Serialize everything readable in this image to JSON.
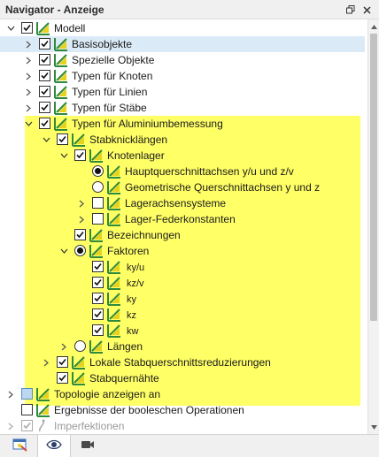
{
  "panel": {
    "title": "Navigator - Anzeige",
    "float_icon": "float-window-icon",
    "close_icon": "close-icon"
  },
  "colors": {
    "highlight": "#ffff66",
    "selection": "#dbeaf7",
    "icon_green": "#2e8b3a",
    "icon_yellow": "#e7d21e"
  },
  "tree": {
    "modell": "Modell",
    "basisobjekte": "Basisobjekte",
    "spezielle_objekte": "Spezielle Objekte",
    "typen_knoten": "Typen für Knoten",
    "typen_linien": "Typen für Linien",
    "typen_staebe": "Typen für Stäbe",
    "typen_alu": "Typen für Aluminiumbemessung",
    "stabknicklaengen": "Stabknicklängen",
    "knotenlager": "Knotenlager",
    "hauptquerschnitt": "Hauptquerschnittachsen y/u und z/v",
    "geometrische": "Geometrische Querschnittachsen y und z",
    "lagerachsensysteme": "Lagerachsensysteme",
    "lager_feder": "Lager-Federkonstanten",
    "bezeichnungen": "Bezeichnungen",
    "faktoren": "Faktoren",
    "ky_u": "ky/u",
    "kz_v": "kz/v",
    "ky": "ky",
    "kz": "kz",
    "kw": "kw",
    "laengen": "Längen",
    "lokale_reduz": "Lokale Stabquerschnittsreduzierungen",
    "stabquernaehte": "Stabquernähte",
    "topologie": "Topologie anzeigen an",
    "boolesche": "Ergebnisse der booleschen Operationen",
    "imperfektionen": "Imperfektionen"
  },
  "bottom_tabs": [
    {
      "name": "data-tab",
      "icon": "data-icon"
    },
    {
      "name": "display-tab",
      "icon": "eye-icon"
    },
    {
      "name": "views-tab",
      "icon": "camera-icon"
    }
  ]
}
